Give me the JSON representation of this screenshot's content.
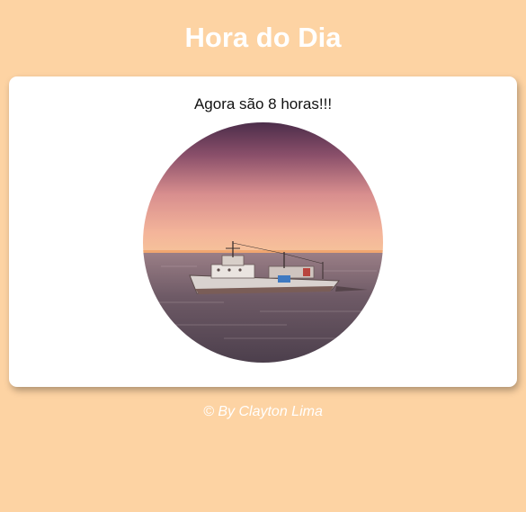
{
  "page": {
    "title": "Hora do Dia",
    "footer": "© By Clayton Lima"
  },
  "card": {
    "message": "Agora são 8 horas!!!",
    "image_subject": "fishing-boat-at-sunset"
  },
  "colors": {
    "background": "#fdd3a3",
    "card": "#ffffff",
    "header_text": "#ffffff",
    "message_text": "#111111"
  }
}
